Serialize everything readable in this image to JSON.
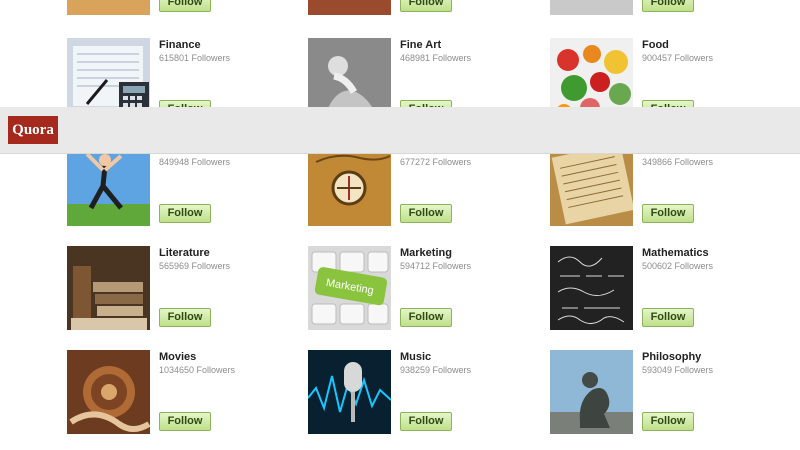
{
  "header": {
    "logo_text": "Quora"
  },
  "follow_label": "Follow",
  "rows": [
    {
      "top": [
        {
          "name": "",
          "followers": "",
          "icon": "top-row-partial-1"
        },
        {
          "name": "",
          "followers": "",
          "icon": "top-row-partial-2"
        },
        {
          "name": "",
          "followers": "",
          "icon": "top-row-partial-3"
        }
      ]
    },
    {
      "tiles": [
        {
          "name": "Finance",
          "followers": "615801 Followers",
          "icon": "finance-thumb"
        },
        {
          "name": "Fine Art",
          "followers": "468981 Followers",
          "icon": "fine-art-thumb"
        },
        {
          "name": "Food",
          "followers": "900457 Followers",
          "icon": "food-thumb"
        }
      ]
    },
    {
      "tiles": [
        {
          "name": "",
          "followers": "849948 Followers",
          "icon": "fitness-thumb"
        },
        {
          "name": "",
          "followers": "677272 Followers",
          "icon": "travel-thumb"
        },
        {
          "name": "",
          "followers": "349866 Followers",
          "icon": "paper-thumb"
        }
      ]
    },
    {
      "tiles": [
        {
          "name": "Literature",
          "followers": "565969 Followers",
          "icon": "literature-thumb"
        },
        {
          "name": "Marketing",
          "followers": "594712 Followers",
          "icon": "marketing-thumb"
        },
        {
          "name": "Mathematics",
          "followers": "500602 Followers",
          "icon": "mathematics-thumb"
        }
      ]
    },
    {
      "tiles": [
        {
          "name": "Movies",
          "followers": "1034650 Followers",
          "icon": "movies-thumb"
        },
        {
          "name": "Music",
          "followers": "938259 Followers",
          "icon": "music-thumb"
        },
        {
          "name": "Philosophy",
          "followers": "593049 Followers",
          "icon": "philosophy-thumb"
        }
      ]
    }
  ],
  "thumb_svg": {
    "finance": "<svg viewBox='0 0 83 84'><rect width='83' height='84' fill='#cfd8e2'/><rect x='6' y='8' width='70' height='60' fill='#f2f5f8'/><g stroke='#9fb1c6' stroke-width='1'><line x1='10' y1='16' x2='72' y2='16'/><line x1='10' y1='24' x2='72' y2='24'/><line x1='10' y1='32' x2='72' y2='32'/><line x1='10' y1='40' x2='72' y2='40'/><line x1='10' y1='48' x2='72' y2='48'/></g><rect x='52' y='44' width='30' height='34' fill='#2b3138'/><rect x='56' y='48' width='22' height='7' fill='#8aa6b6'/><g fill='#dbe2e8'><rect x='56' y='58' width='5' height='4'/><rect x='63' y='58' width='5' height='4'/><rect x='70' y='58' width='5' height='4'/><rect x='56' y='65' width='5' height='4'/><rect x='63' y='65' width='5' height='4'/><rect x='70' y='65' width='5' height='4'/></g><line x1='20' y1='66' x2='40' y2='42' stroke='#1b1b1b' stroke-width='3'/></svg>",
    "fineart": "<svg viewBox='0 0 83 84'><rect width='83' height='84' fill='#8a8a8a'/><circle cx='30' cy='28' r='10' fill='#dedede'/><path d='M20 70 Q32 46 50 55 Q62 62 70 80 L20 84 Z' fill='#c4c4c4'/><path d='M26 38 Q38 40 46 54' stroke='#efefef' stroke-width='7' fill='none'/><rect x='0' y='0' width='83' height='84' fill='url(#g)' opacity='0'/></svg>",
    "food": "<svg viewBox='0 0 83 84'><rect width='83' height='84' fill='#f0f0f0'/><circle cx='18' cy='22' r='11' fill='#d9342b'/><circle cx='42' cy='16' r='9' fill='#e8881e'/><circle cx='66' cy='24' r='12' fill='#f1c232'/><circle cx='24' cy='50' r='13' fill='#3f9a2f'/><circle cx='50' cy='44' r='10' fill='#cc1f1f'/><circle cx='70' cy='56' r='11' fill='#6aa84f'/><circle cx='40' cy='70' r='10' fill='#e06666'/><circle cx='14' cy='74' r='8' fill='#ff9900'/></svg>",
    "fitness": "<svg viewBox='0 0 83 84'><rect width='83' height='84' fill='#5ea4e3'/><rect y='62' width='83' height='22' fill='#61a83a'/><circle cx='38' cy='18' r='6' fill='#f2c8a3'/><path d='M38 24 L36 44 L24 66' stroke='#1f1f1f' stroke-width='5' fill='none'/><path d='M36 44 L54 66' stroke='#1f1f1f' stroke-width='5' fill='none'/><path d='M36 28 L20 12 M38 28 L54 14' stroke='#f2c8a3' stroke-width='4'/></svg>",
    "travel": "<svg viewBox='0 0 83 84'><rect width='83' height='84' fill='#c18935'/><circle cx='41' cy='46' r='16' fill='#f3e5c1' stroke='#5c3c14' stroke-width='3'/><line x1='41' y1='34' x2='41' y2='58' stroke='#a52a2a' stroke-width='2'/><line x1='29' y1='46' x2='53' y2='46' stroke='#5c3c14' stroke-width='2'/><path d='M8 20 Q30 10 52 16 Q70 20 82 14' stroke='#6e4517' stroke-width='2' fill='none'/></svg>",
    "paper": "<svg viewBox='0 0 83 84'><rect width='83' height='84' fill='#b98d45'/><rect x='8' y='8' width='70' height='68' fill='#e9d4a5' transform='rotate(-12 42 42)'/><g stroke='#8e6a33' stroke-width='1' transform='rotate(-12 42 42)'><line x1='14' y1='20' x2='70' y2='20'/><line x1='14' y1='28' x2='70' y2='28'/><line x1='14' y1='36' x2='70' y2='36'/><line x1='14' y1='44' x2='70' y2='44'/><line x1='14' y1='52' x2='70' y2='52'/><line x1='14' y1='60' x2='70' y2='60'/></g></svg>",
    "literature": "<svg viewBox='0 0 83 84'><rect width='83' height='84' fill='#4a3522'/><rect x='6' y='20' width='18' height='60' fill='#7d5734'/><rect x='26' y='36' width='50' height='10' fill='#b59a76'/><rect x='28' y='48' width='48' height='10' fill='#8a6a46'/><rect x='30' y='60' width='46' height='10' fill='#c8b08d'/><rect x='4' y='72' width='76' height='12' fill='#d8c7a8'/></svg>",
    "marketing": "<svg viewBox='0 0 83 84'><rect width='83' height='84' fill='#d9d9d9'/><g fill='#f7f7f7' stroke='#bcbcbc'><rect x='4' y='6' width='24' height='20' rx='3'/><rect x='32' y='6' width='24' height='20' rx='3'/><rect x='60' y='6' width='20' height='20' rx='3'/><rect x='4' y='58' width='24' height='20' rx='3'/><rect x='32' y='58' width='24' height='20' rx='3'/><rect x='60' y='58' width='20' height='20' rx='3'/></g><rect x='8' y='26' width='70' height='28' rx='5' fill='#8ac43f' transform='rotate(10 42 40)'/><text x='42' y='44' font-size='11' font-family='Liberation Sans, sans-serif' fill='#fff' text-anchor='middle' transform='rotate(10 42 40)'>Marketing</text></svg>",
    "mathematics": "<svg viewBox='0 0 83 84'><rect width='83' height='84' fill='#222'/><g fill='none' stroke='#d9d9d9' stroke-width='1'><path d='M8 16 Q20 6 30 16 Q40 26 52 12'/><path d='M10 30 L30 30 M36 30 L52 30 M58 30 L74 30'/><path d='M8 46 Q20 38 34 46 Q48 54 64 44'/><path d='M12 62 L28 62 M34 62 L70 62'/><path d='M8 74 Q20 66 30 74 Q42 82 54 72 Q62 68 74 76'/></g></svg>",
    "movies": "<svg viewBox='0 0 83 84'><rect width='83' height='84' fill='#6d3b1f'/><circle cx='42' cy='42' r='26' fill='#b06a35'/><circle cx='42' cy='42' r='18' fill='#7c4422'/><circle cx='42' cy='42' r='8' fill='#d9a76b'/><path d='M4 72 Q28 56 52 74 Q66 84 82 74' stroke='#e6c59d' stroke-width='6' fill='none'/></svg>",
    "music": "<svg viewBox='0 0 83 84'><rect width='83' height='84' fill='#082030'/><path d='M0 48 L8 38 L16 58 L24 26 L32 62 L40 34 L48 54 L56 30 L64 56 L72 40 L83 50' stroke='#18c6ff' stroke-width='2' fill='none'/><rect x='36' y='12' width='18' height='30' rx='9' fill='#d8d8d8'/><rect x='43' y='42' width='4' height='30' fill='#b9b9b9'/></svg>",
    "philosophy": "<svg viewBox='0 0 83 84'><rect width='83' height='84' fill='#8fb7d6'/><rect y='62' width='83' height='22' fill='#7b7f7a'/><path d='M30 72 Q28 50 42 40 Q54 34 58 46 Q62 56 54 64 L60 78 L30 78 Z' fill='#3e4540'/><circle cx='40' cy='30' r='8' fill='#444b46'/></svg>"
  }
}
